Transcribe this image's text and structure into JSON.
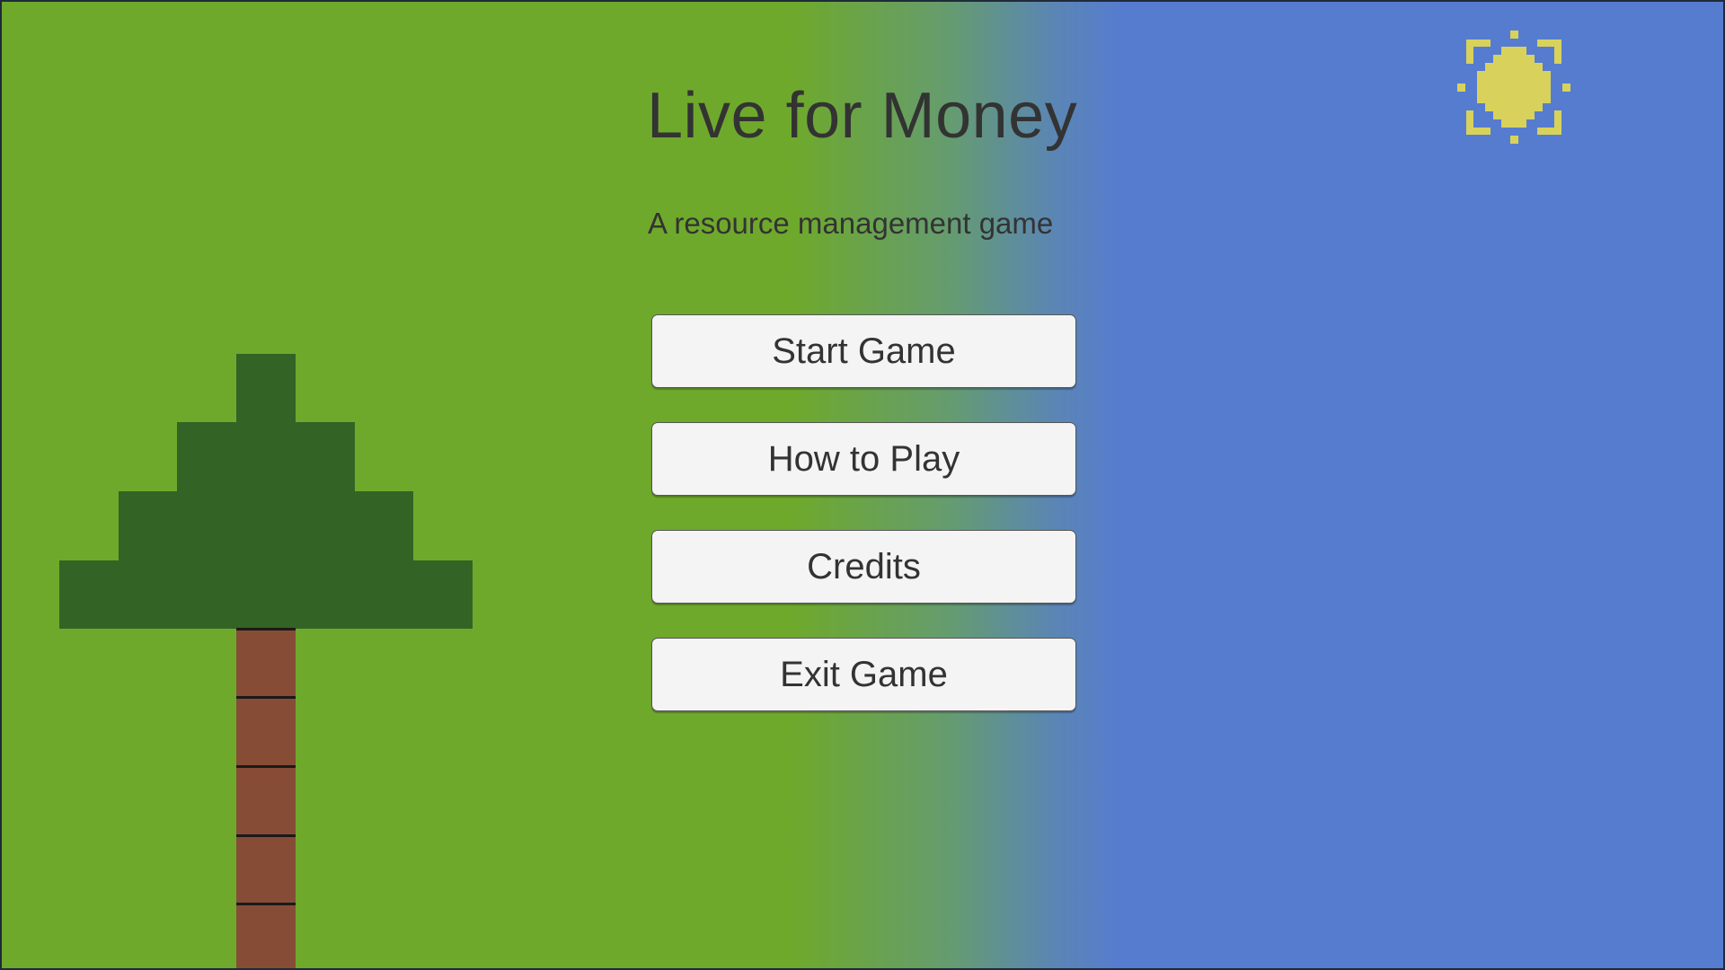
{
  "game": {
    "title": "Live for Money",
    "subtitle": "A resource management game"
  },
  "menu": {
    "start_label": "Start Game",
    "how_to_play_label": "How to Play",
    "credits_label": "Credits",
    "exit_label": "Exit Game"
  },
  "colors": {
    "grass": "#6ea92c",
    "sky": "#567ccf",
    "tree_leaves": "#336325",
    "tree_trunk": "#874c36",
    "sun": "#d8d25c",
    "text": "#333333",
    "button_bg": "#f4f4f4"
  },
  "icons": {
    "sun": "pixel-sun-icon",
    "tree": "pixel-tree"
  }
}
